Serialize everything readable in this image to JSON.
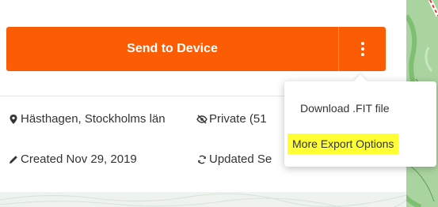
{
  "actions": {
    "send_label": "Send to Device",
    "more_icon": "kebab-vertical-icon",
    "accent": "#fc5c04"
  },
  "details": {
    "location": "Hästhagen, Stockholms län",
    "location_icon": "map-pin-icon",
    "privacy": "Private (51",
    "privacy_icon": "eye-off-icon",
    "created": "Created Nov 29, 2019",
    "created_icon": "pencil-icon",
    "updated": "Updated Se",
    "updated_icon": "sync-icon"
  },
  "export_menu": {
    "items": [
      {
        "label": "Download .FIT file"
      },
      {
        "label": "More Export Options",
        "highlight": "#ffff33"
      }
    ]
  }
}
